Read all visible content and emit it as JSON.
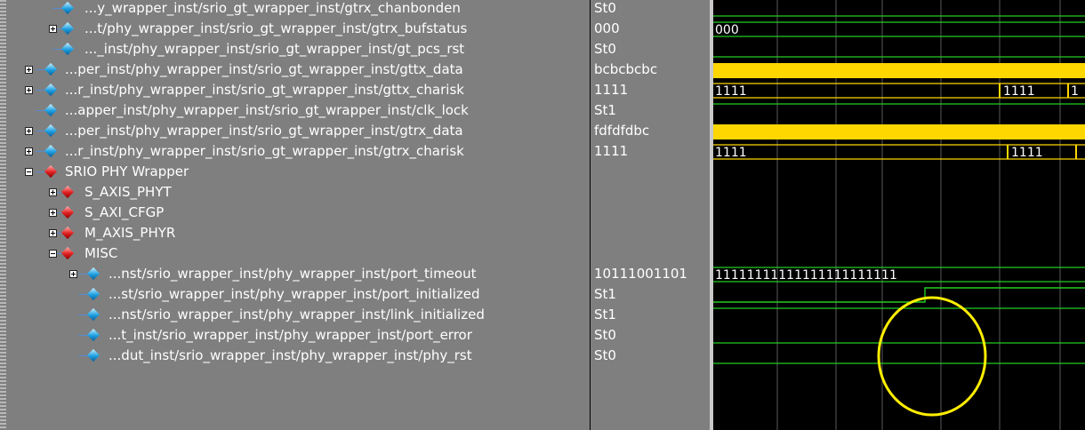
{
  "signals": [
    {
      "name": "...y_wrapper_inst/srio_gt_wrapper_inst/gtrx_chanbonden",
      "value": "St0"
    },
    {
      "name": "...t/phy_wrapper_inst/srio_gt_wrapper_inst/gtrx_bufstatus",
      "value": "000"
    },
    {
      "name": "..._inst/phy_wrapper_inst/srio_gt_wrapper_inst/gt_pcs_rst",
      "value": "St0"
    },
    {
      "name": "...per_inst/phy_wrapper_inst/srio_gt_wrapper_inst/gttx_data",
      "value": "bcbcbcbc"
    },
    {
      "name": "...r_inst/phy_wrapper_inst/srio_gt_wrapper_inst/gttx_charisk",
      "value": "1111"
    },
    {
      "name": "...apper_inst/phy_wrapper_inst/srio_gt_wrapper_inst/clk_lock",
      "value": "St1"
    },
    {
      "name": "...per_inst/phy_wrapper_inst/srio_gt_wrapper_inst/gtrx_data",
      "value": "fdfdfdbc"
    },
    {
      "name": "...r_inst/phy_wrapper_inst/srio_gt_wrapper_inst/gtrx_charisk",
      "value": "1111"
    },
    {
      "name": "SRIO PHY Wrapper",
      "value": ""
    },
    {
      "name": "S_AXIS_PHYT",
      "value": ""
    },
    {
      "name": "S_AXI_CFGP",
      "value": ""
    },
    {
      "name": "M_AXIS_PHYR",
      "value": ""
    },
    {
      "name": "MISC",
      "value": ""
    },
    {
      "name": "...nst/srio_wrapper_inst/phy_wrapper_inst/port_timeout",
      "value": "10111001101"
    },
    {
      "name": "...st/srio_wrapper_inst/phy_wrapper_inst/port_initialized",
      "value": "St1"
    },
    {
      "name": "...nst/srio_wrapper_inst/phy_wrapper_inst/link_initialized",
      "value": "St1"
    },
    {
      "name": "...t_inst/srio_wrapper_inst/phy_wrapper_inst/port_error",
      "value": "St0"
    },
    {
      "name": "...dut_inst/srio_wrapper_inst/phy_wrapper_inst/phy_rst",
      "value": "St0"
    }
  ],
  "wave_labels": {
    "bufstatus": "000",
    "gttx_charisk_a": "1111",
    "gttx_charisk_b": "1111",
    "gttx_charisk_c": "1",
    "gtrx_charisk_a": "1111",
    "gtrx_charisk_b": "1111",
    "port_timeout": "11111111111111111111111"
  },
  "colors": {
    "panel_bg": "#7f7f7f",
    "wave_bg": "#000000",
    "wave_green": "#22cc22",
    "wave_yellow": "#ffd700",
    "highlight_circle": "#ffee00"
  }
}
